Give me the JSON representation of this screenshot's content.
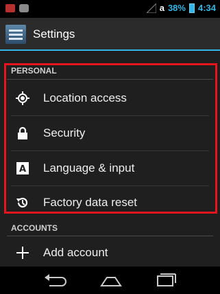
{
  "status": {
    "battery_pct": "38%",
    "time": "4:34",
    "carrier_glyph": "a",
    "icons": [
      "notification-red-icon",
      "notification-gray-icon",
      "signal-icon",
      "battery-icon"
    ]
  },
  "actionbar": {
    "title": "Settings",
    "icon": "settings-app-icon"
  },
  "sections": {
    "personal": "PERSONAL",
    "accounts": "ACCOUNTS"
  },
  "items": {
    "location": {
      "label": "Location access",
      "icon": "location-icon"
    },
    "security": {
      "label": "Security",
      "icon": "lock-icon"
    },
    "language": {
      "label": "Language & input",
      "icon": "keyboard-a-icon"
    },
    "factory": {
      "label": "Factory data reset",
      "icon": "reset-icon"
    },
    "add_account": {
      "label": "Add account",
      "icon": "plus-icon"
    }
  },
  "nav": [
    "back-icon",
    "home-icon",
    "recents-icon"
  ],
  "colors": {
    "accent": "#33b5e5",
    "highlight": "#e8141e",
    "background": "#1f1f1f"
  }
}
